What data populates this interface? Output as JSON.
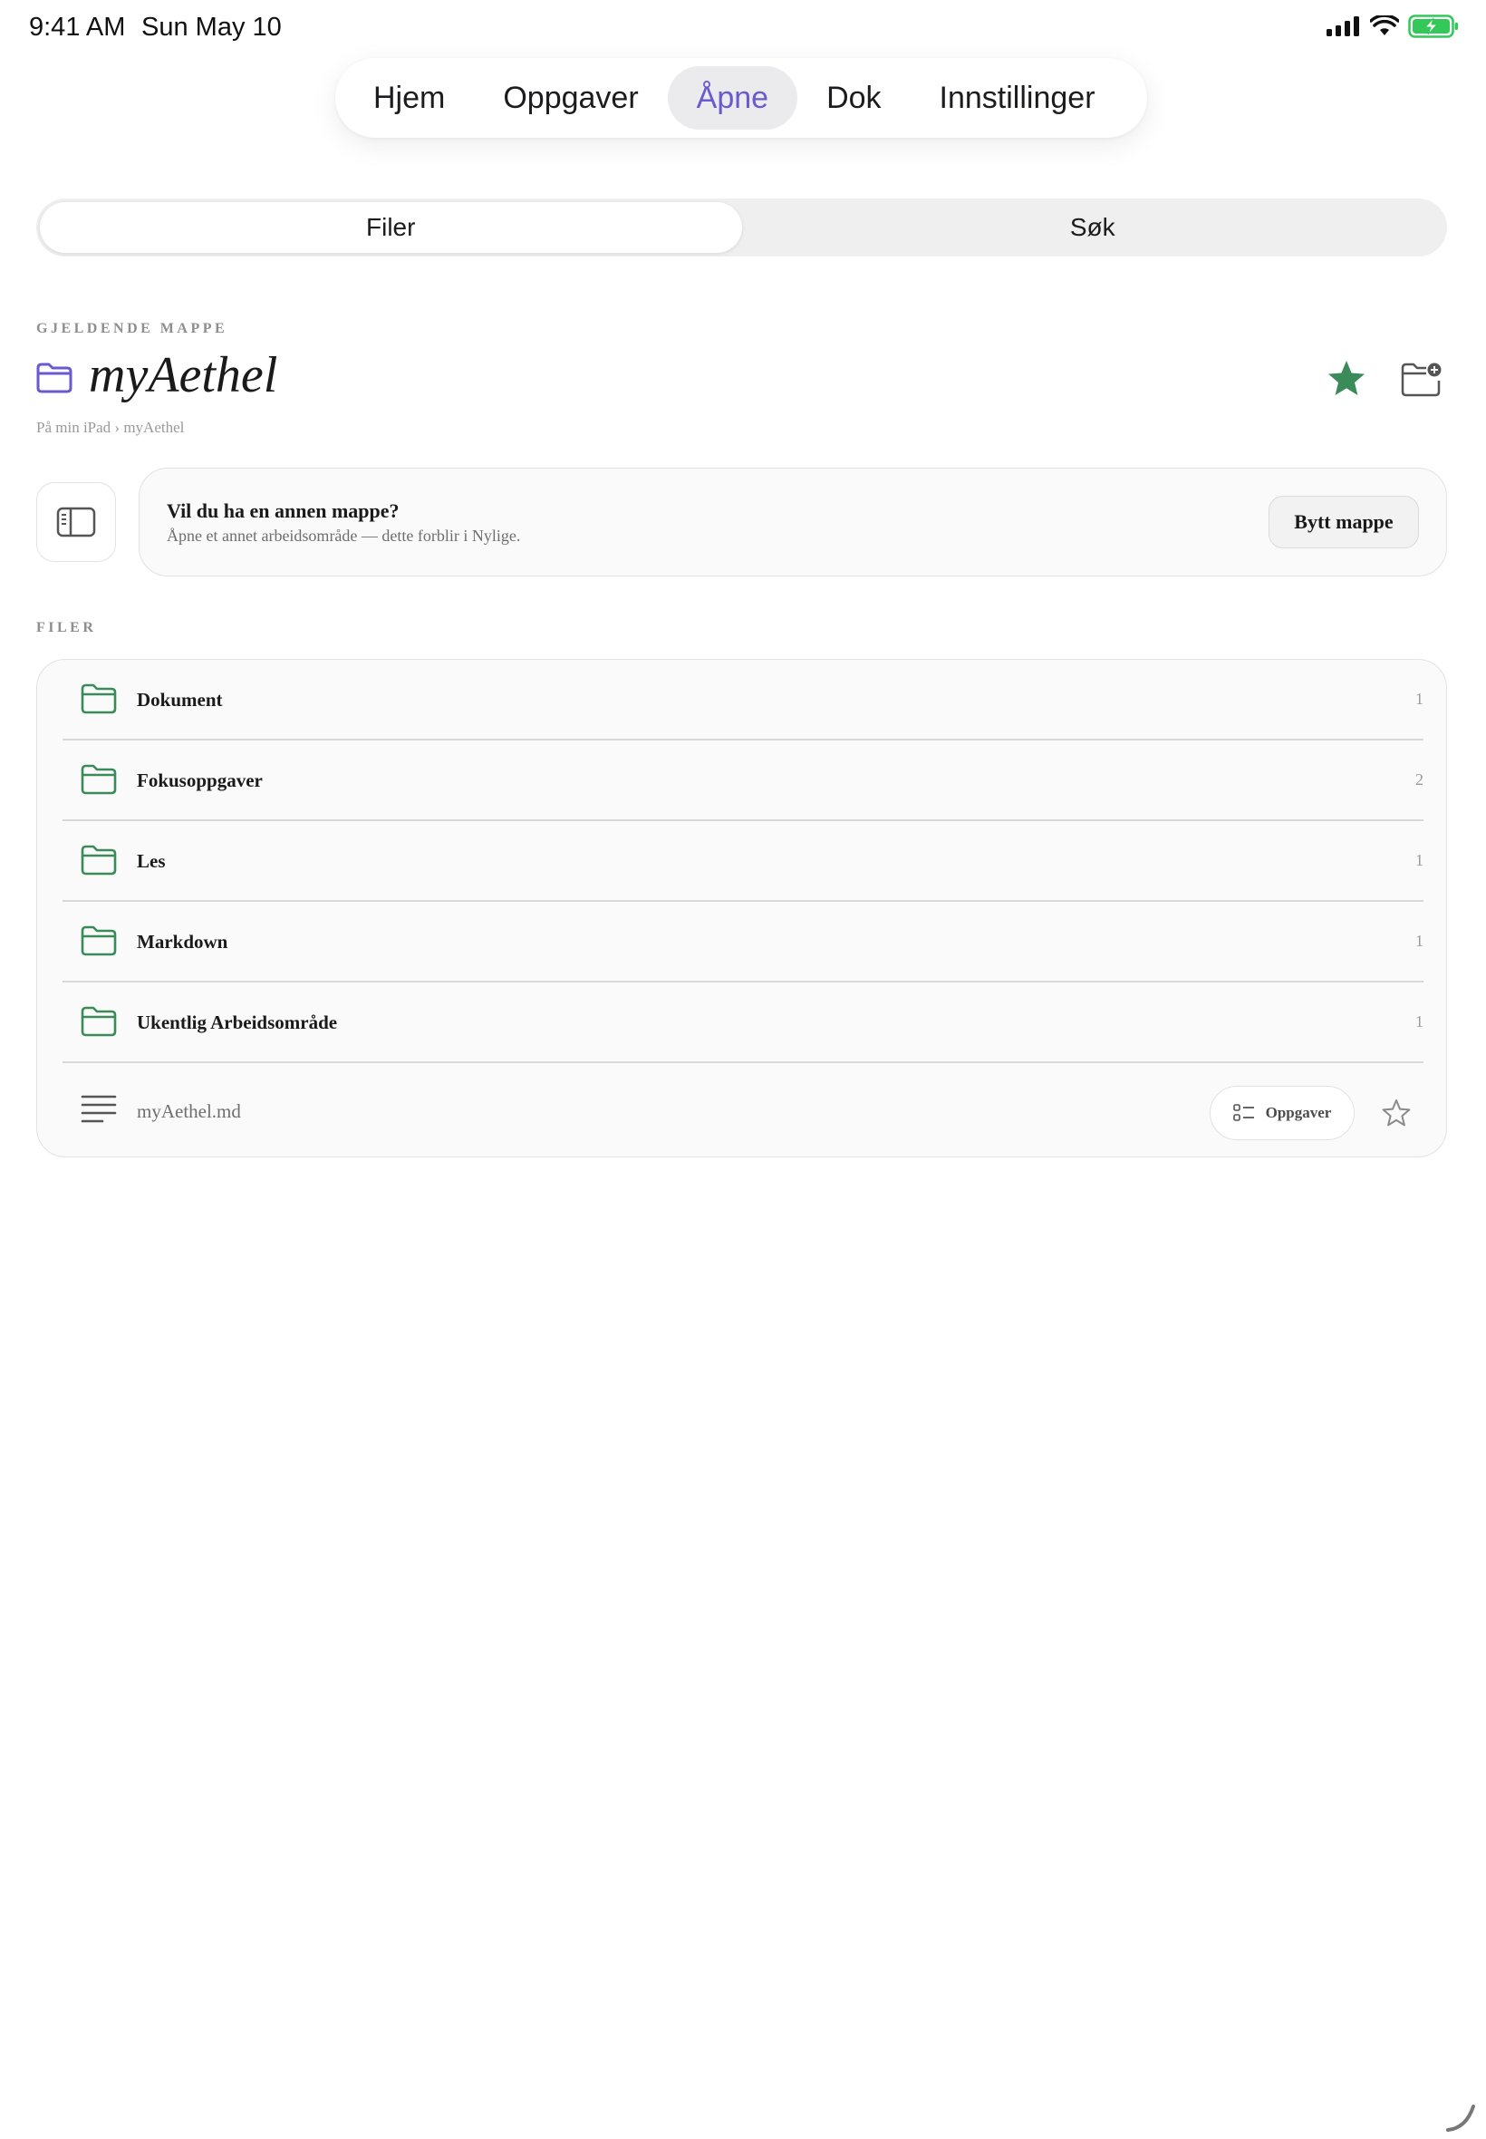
{
  "status_bar": {
    "time": "9:41 AM",
    "date": "Sun May 10"
  },
  "nav": {
    "tabs": [
      "Hjem",
      "Oppgaver",
      "Åpne",
      "Dok",
      "Innstillinger"
    ],
    "active_index": 2
  },
  "segmented": {
    "items": [
      "Filer",
      "Søk"
    ],
    "active_index": 0
  },
  "current_folder": {
    "section_label": "GJELDENDE MAPPE",
    "name": "myAethel",
    "breadcrumb": "På min iPad › myAethel",
    "favorited": true
  },
  "switch_card": {
    "title": "Vil du ha en annen mappe?",
    "subtitle": "Åpne et annet arbeidsområde — dette forblir i Nylige.",
    "button": "Bytt mappe"
  },
  "files": {
    "section_label": "FILER",
    "folders": [
      {
        "name": "Dokument",
        "count": "1"
      },
      {
        "name": "Fokusoppgaver",
        "count": "2"
      },
      {
        "name": "Les",
        "count": "1"
      },
      {
        "name": "Markdown",
        "count": "1"
      },
      {
        "name": "Ukentlig Arbeidsområde",
        "count": "1"
      }
    ],
    "documents": [
      {
        "name": "myAethel.md",
        "tasks_label": "Oppgaver"
      }
    ]
  },
  "colors": {
    "accent": "#6a5acd",
    "folder_green": "#3a8a5a",
    "star_green": "#3a8a5a"
  }
}
